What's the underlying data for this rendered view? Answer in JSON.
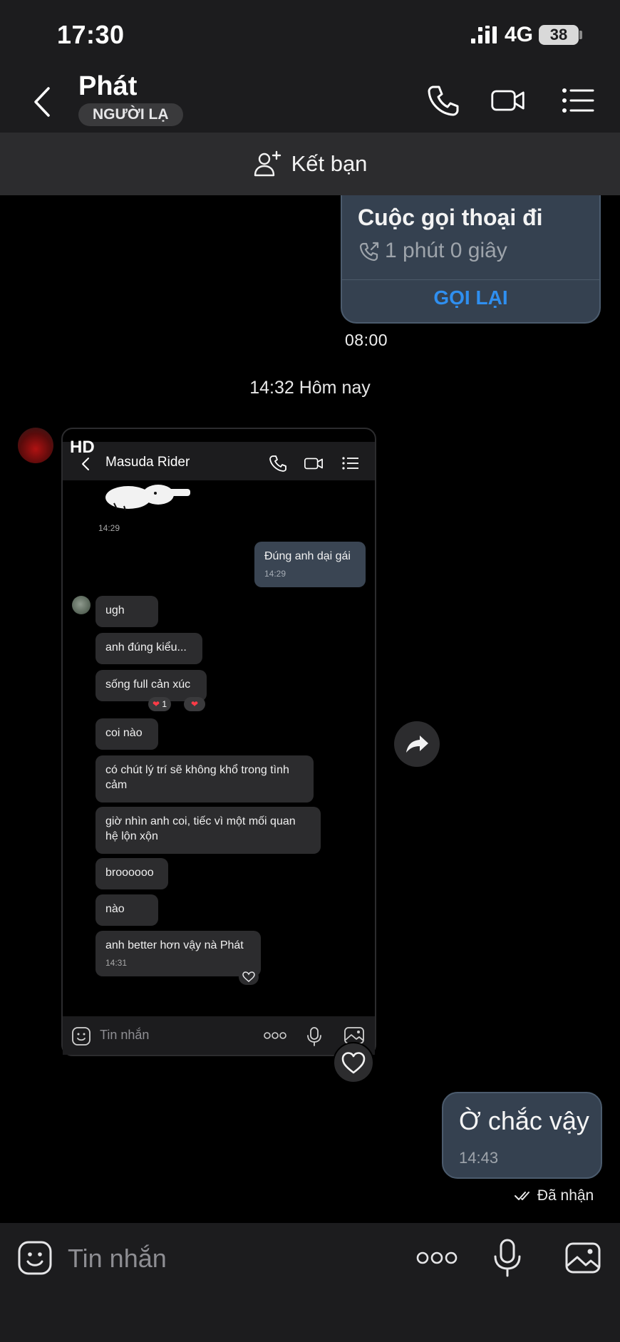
{
  "status_bar": {
    "time": "17:30",
    "network": "4G",
    "battery": "38"
  },
  "header": {
    "name": "Phát",
    "badge": "NGƯỜI LẠ",
    "icons": [
      "back-icon",
      "phone-icon",
      "video-icon",
      "menu-icon"
    ]
  },
  "friend_bar": {
    "label": "Kết bạn",
    "icon": "add-friend-icon"
  },
  "call_card": {
    "title": "Cuộc gọi thoại đi",
    "duration": "1 phút 0 giây",
    "action": "GỌI LẠI",
    "time": "08:00"
  },
  "date_separator": "14:32 Hôm nay",
  "image_message": {
    "badge": "HD",
    "inner": {
      "contact": "Masuda Rider",
      "sticker_time": "14:29",
      "outgoing": {
        "text": "Đúng anh dại gái",
        "time": "14:29"
      },
      "incoming": [
        {
          "text": "ugh"
        },
        {
          "text": "anh đúng kiểu..."
        },
        {
          "text": "sống full cản xúc",
          "reaction": "1"
        },
        {
          "text": "coi nào"
        },
        {
          "text": "có chút lý trí sẽ không khổ trong tình cảm"
        },
        {
          "text": "giờ nhìn anh coi, tiếc vì một mối quan hệ lộn xộn"
        },
        {
          "text": "broooooo"
        },
        {
          "text": "nào"
        },
        {
          "text": "anh better hơn vậy nà Phát",
          "time": "14:31"
        }
      ],
      "input_placeholder": "Tin nhắn"
    }
  },
  "outgoing_message": {
    "text": "Ờ chắc vậy",
    "time": "14:43",
    "status": "Đã nhận"
  },
  "composer": {
    "placeholder": "Tin nhắn"
  },
  "colors": {
    "accent": "#2f8ff0",
    "outgoing_bubble": "#354150",
    "background": "#000000",
    "bar": "#1c1c1e"
  }
}
